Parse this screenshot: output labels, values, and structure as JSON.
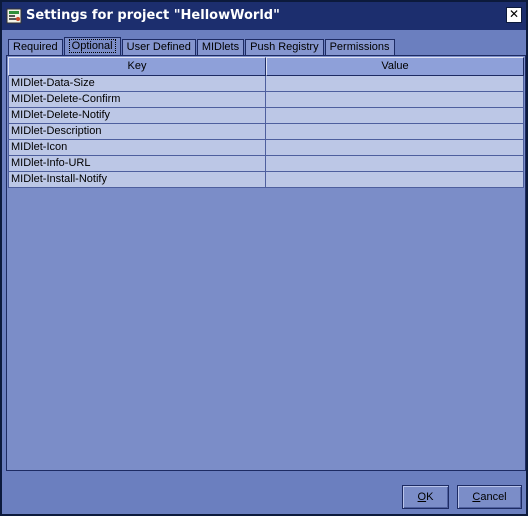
{
  "window": {
    "title": "Settings for project \"HellowWorld\"",
    "close_glyph": "✕",
    "app_icon": "settings-app-icon"
  },
  "tabs": [
    {
      "label": "Required",
      "active": false
    },
    {
      "label": "Optional",
      "active": true
    },
    {
      "label": "User Defined",
      "active": false
    },
    {
      "label": "MIDlets",
      "active": false
    },
    {
      "label": "Push Registry",
      "active": false
    },
    {
      "label": "Permissions",
      "active": false
    }
  ],
  "table": {
    "columns": [
      "Key",
      "Value"
    ],
    "rows": [
      {
        "key": "MIDlet-Data-Size",
        "value": ""
      },
      {
        "key": "MIDlet-Delete-Confirm",
        "value": ""
      },
      {
        "key": "MIDlet-Delete-Notify",
        "value": ""
      },
      {
        "key": "MIDlet-Description",
        "value": ""
      },
      {
        "key": "MIDlet-Icon",
        "value": ""
      },
      {
        "key": "MIDlet-Info-URL",
        "value": ""
      },
      {
        "key": "MIDlet-Install-Notify",
        "value": ""
      }
    ]
  },
  "buttons": {
    "ok": {
      "mnemonic": "O",
      "rest": "K"
    },
    "cancel": {
      "mnemonic": "C",
      "rest": "ancel"
    }
  },
  "colors": {
    "titlebar": "#1c2e6e",
    "panel": "#7b8dc8",
    "cell": "#bcc7e6"
  }
}
